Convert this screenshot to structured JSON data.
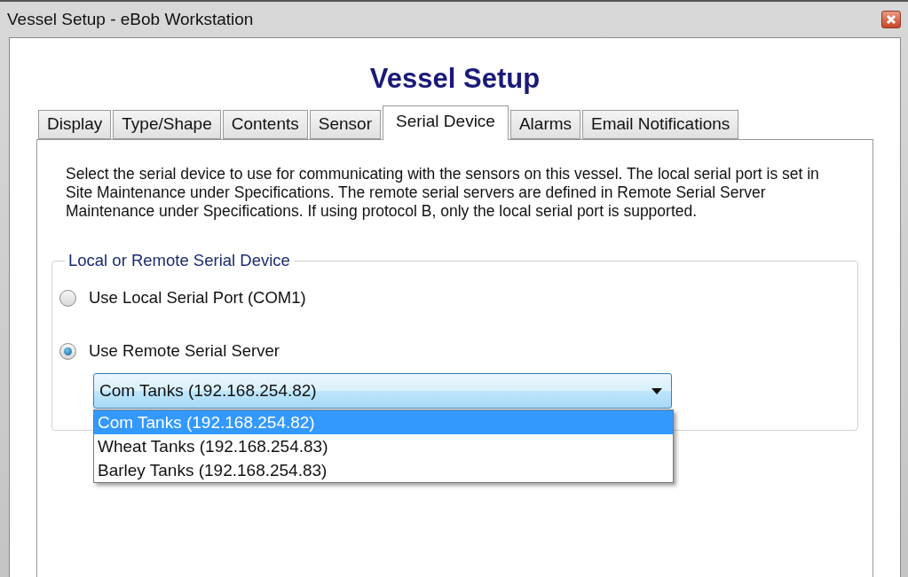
{
  "window": {
    "title": "Vessel Setup - eBob Workstation"
  },
  "heading": "Vessel Setup",
  "tabs": [
    {
      "label": "Display",
      "selected": false
    },
    {
      "label": "Type/Shape",
      "selected": false
    },
    {
      "label": "Contents",
      "selected": false
    },
    {
      "label": "Sensor",
      "selected": false
    },
    {
      "label": "Serial Device",
      "selected": true
    },
    {
      "label": "Alarms",
      "selected": false
    },
    {
      "label": "Email Notifications",
      "selected": false
    }
  ],
  "description": "Select the serial device to use for communicating with the sensors on this vessel. The local serial port is set in Site Maintenance under Specifications.  The remote serial servers are defined in Remote Serial Server Maintenance under Specifications.  If using protocol B, only the local serial port is supported.",
  "group": {
    "title": "Local or Remote Serial Device",
    "options": [
      {
        "label": "Use Local Serial Port (COM1)",
        "selected": false
      },
      {
        "label": "Use Remote Serial Server",
        "selected": true
      }
    ],
    "combo": {
      "value": "Com Tanks (192.168.254.82)",
      "expanded": true,
      "items": [
        {
          "label": "Com Tanks (192.168.254.82)",
          "selected": true
        },
        {
          "label": "Wheat Tanks (192.168.254.83)",
          "selected": false
        },
        {
          "label": "Barley Tanks (192.168.254.83)",
          "selected": false
        }
      ]
    }
  }
}
